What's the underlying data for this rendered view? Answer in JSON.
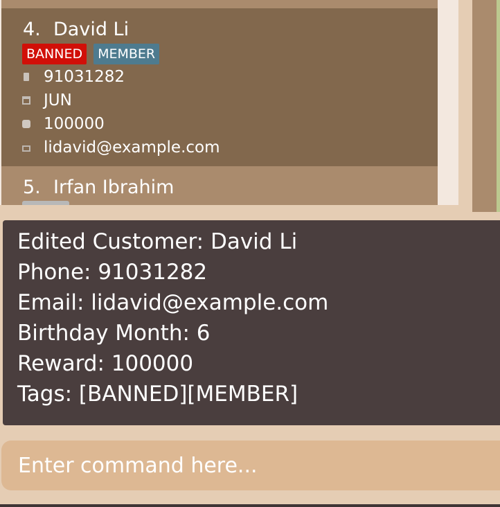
{
  "customer_list": {
    "selected_card": {
      "index": "4.",
      "name": "David Li",
      "tags": [
        "BANNED",
        "MEMBER"
      ],
      "phone": "91031282",
      "birthday_month": "JUN",
      "reward": "100000",
      "email": "lidavid@example.com",
      "icons": {
        "phone": "phone-icon",
        "birthday": "calendar-icon",
        "reward": "gift-icon",
        "email": "email-icon"
      }
    },
    "next_card": {
      "index": "5.",
      "name": "Irfan Ibrahim"
    }
  },
  "result_display": {
    "lines": [
      "Edited Customer: David Li",
      "Phone: 91031282",
      "Email: lidavid@example.com",
      "Birthday Month: 6",
      "Reward: 100000",
      "Tags: [BANNED][MEMBER]"
    ]
  },
  "command_box": {
    "placeholder": "Enter command here...",
    "value": ""
  },
  "colors": {
    "background": "#e5cdb4",
    "selected_card": "#82684d",
    "card": "#aa8b6d",
    "banned_tag": "#d10f08",
    "member_tag": "#4e7b8f",
    "result_panel": "#4a3e3e",
    "command_box": "#ddb893"
  }
}
